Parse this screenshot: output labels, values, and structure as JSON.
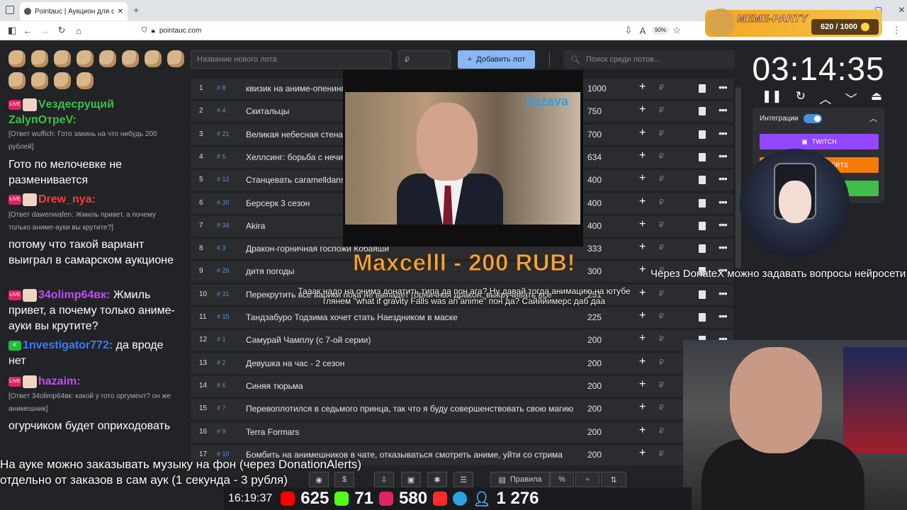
{
  "browser": {
    "tab_title": "Pointauc | Аукцион для стримеров",
    "url": "pointauc.com",
    "zoom": "90%"
  },
  "meme_party": {
    "title": "MEME-PARTY",
    "counter": "620 / 1000"
  },
  "chat": [
    {
      "user": "Vездесрущий ZаlупОтреV:",
      "quote": "",
      "text": ""
    },
    {
      "user": "",
      "quote": "[Ответ wuffich: Гото закинь на что нибудь 200 рублей]",
      "text": "Гото по мелочевке не разменивается"
    },
    {
      "user": "Drew_nya:",
      "quote": "[Ответ dawenwafen: Жмиль привет, а почему только аниме-ауки вы крутите?]",
      "text": "потому что такой вариант выиграл в самарском аукционе"
    },
    {
      "user": "34olimp64вк:",
      "quote": "",
      "text": "Жмиль привет, а почему только аниме-ауки вы крутите?"
    },
    {
      "user": "1nvestigator772:",
      "quote": "",
      "text": "да вроде нет"
    },
    {
      "user": "hazaim:",
      "quote": "[Ответ 34olimp64вк: какой у гото оргумент? он же анимешник]",
      "text": "огурчиком будет оприходовать"
    }
  ],
  "inputs": {
    "new_lot_placeholder": "Название нового лота",
    "amount_placeholder": "₽",
    "add_lot_label": "Добавить лот",
    "search_placeholder": "Поиск среди лотов..."
  },
  "lots": [
    {
      "n": "1",
      "id": "# 8",
      "name": "квизик на аниме-опенинги",
      "amount": "1000"
    },
    {
      "n": "2",
      "id": "# 4",
      "name": "Скитальцы",
      "amount": "750"
    },
    {
      "n": "3",
      "id": "# 21",
      "name": "Великая небесная стена",
      "amount": "700"
    },
    {
      "n": "4",
      "id": "# 5",
      "name": "Хеллсинг: борьба с нечистью",
      "amount": "634"
    },
    {
      "n": "5",
      "id": "# 12",
      "name": "Станцевать caramelldansen",
      "amount": "400"
    },
    {
      "n": "6",
      "id": "# 30",
      "name": "Берсерк 3 сезон",
      "amount": "400"
    },
    {
      "n": "7",
      "id": "# 34",
      "name": "Akira",
      "amount": "400"
    },
    {
      "n": "8",
      "id": "# 3",
      "name": "Дракон-горничная госпожи Кобаяши",
      "amount": "333"
    },
    {
      "n": "9",
      "id": "# 26",
      "name": "дитя погоды",
      "amount": "300"
    },
    {
      "n": "10",
      "id": "# 31",
      "name": "Перекрутить все варики пока не выпадет горничная дракон, выкручивать все",
      "amount": "251"
    },
    {
      "n": "11",
      "id": "# 15",
      "name": "Тандзабуро Тодзима хочет стать Наездником в маске",
      "amount": "225"
    },
    {
      "n": "12",
      "id": "# 1",
      "name": "Самурай Чамплу (с 7-ой серии)",
      "amount": "200"
    },
    {
      "n": "13",
      "id": "# 2",
      "name": "Девушка на час - 2 сезон",
      "amount": "200"
    },
    {
      "n": "14",
      "id": "# 6",
      "name": "Синяя тюрьма",
      "amount": "200"
    },
    {
      "n": "15",
      "id": "# 7",
      "name": "Перевоплотился в седьмого принца, так что я буду совершенствовать свою магию",
      "amount": "200"
    },
    {
      "n": "16",
      "id": "# 9",
      "name": "Terra Formars",
      "amount": "200"
    },
    {
      "n": "17",
      "id": "# 10",
      "name": "Бомбить на анимешников в чате, отказываться смотреть аниме, уйти со стрима",
      "amount": "200"
    }
  ],
  "video": {
    "logo": "bazava"
  },
  "donation": {
    "title": "Maxcelll - 200 RUB!",
    "message": "Тааак надо на онимэ донатить типа да пон ага? Ну давай тогда анимацию на ютубе глянем \"what if gravity Falls was an anime\" пон да? Сайййимерс даб даа"
  },
  "timer": {
    "value": "03:14:35"
  },
  "integrations": {
    "label": "Интеграции",
    "twitch": "TWITCH",
    "da": "DONATIONALERTS"
  },
  "ticker": "Через DonateX можно задавать вопросы нейросети",
  "subtitles": {
    "line1": "На ауке можно заказывать музыку на фон (через DonationAlerts)",
    "line2": "отдельно от заказов в сам аук (1 секунда - 3 рубля)"
  },
  "toolbar": {
    "rules": "Правила"
  },
  "stats": {
    "clock": "16:19:37",
    "youtube": "625",
    "kick": "71",
    "live": "580",
    "telegram": "1 276"
  },
  "colors": {
    "accent": "#8ab6f2",
    "twitch": "#9146ff",
    "donationalerts": "#f57d07",
    "green": "#3fbf4a",
    "id_blue": "#5b8fd8"
  }
}
